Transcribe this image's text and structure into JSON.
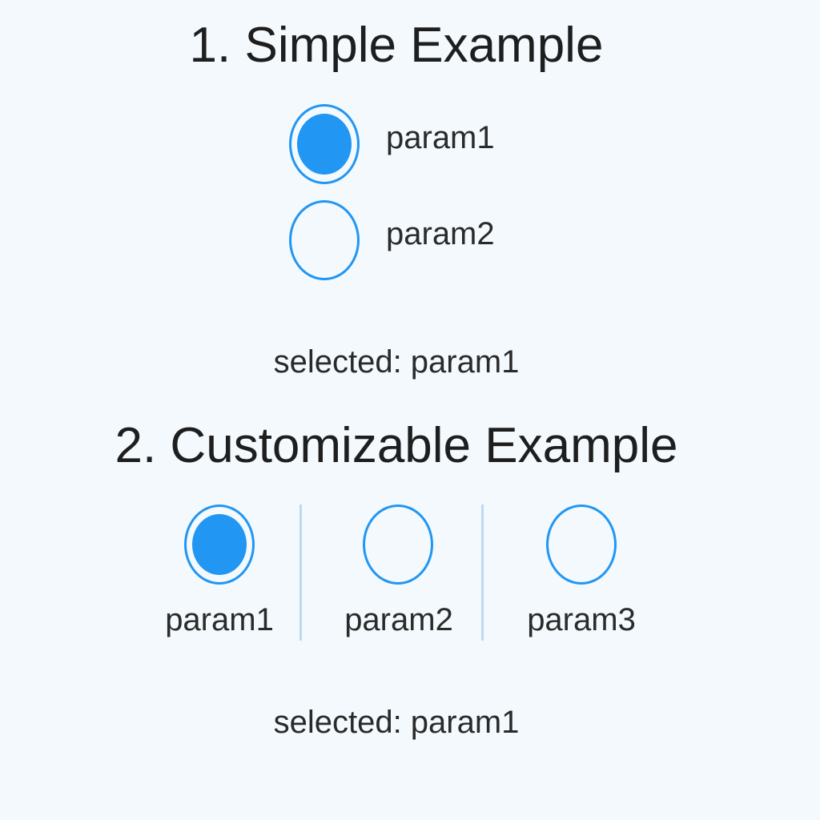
{
  "simple": {
    "title": "1. Simple Example",
    "options": [
      {
        "label": "param1",
        "checked": true
      },
      {
        "label": "param2",
        "checked": false
      }
    ],
    "selected_text": "selected: param1"
  },
  "custom": {
    "title": "2. Customizable Example",
    "options": [
      {
        "label": "param1",
        "checked": true
      },
      {
        "label": "param2",
        "checked": false
      },
      {
        "label": "param3",
        "checked": false
      }
    ],
    "selected_text": "selected: param1"
  },
  "colors": {
    "accent": "#2196f3",
    "background": "#f3f9fd",
    "divider": "#bcdaf2",
    "text": "#222222"
  }
}
